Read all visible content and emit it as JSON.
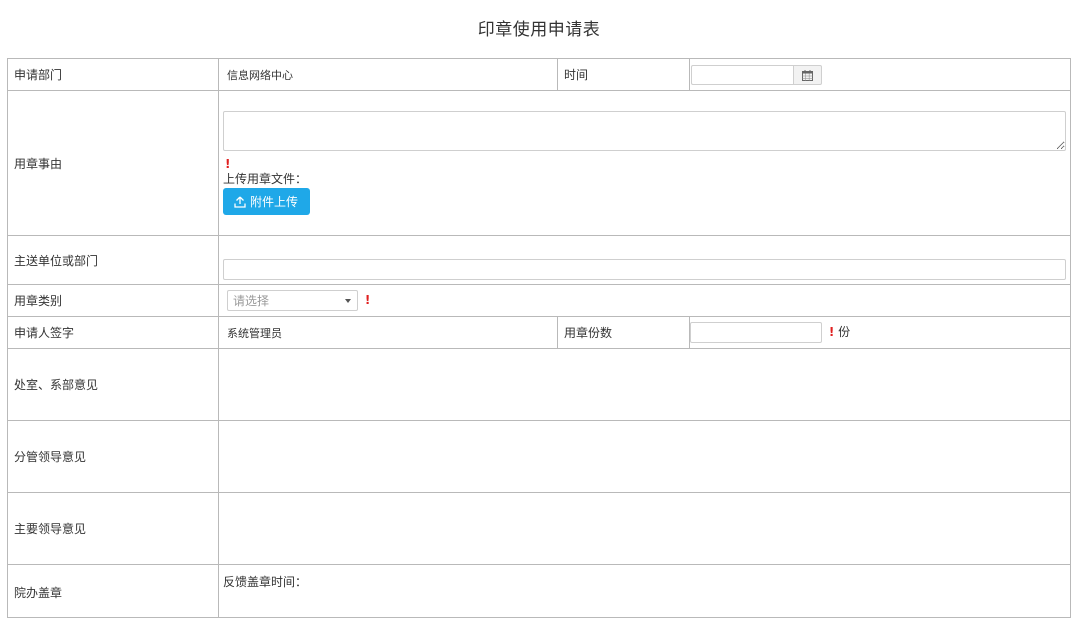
{
  "form": {
    "title": "印章使用申请表",
    "rows": {
      "dept": {
        "label": "申请部门",
        "value": "信息网络中心"
      },
      "time": {
        "label": "时间",
        "calendar_icon": "calendar-icon"
      },
      "reason": {
        "label": "用章事由",
        "required_mark": "!",
        "upload_label": "上传用章文件：",
        "upload_button": "附件上传",
        "upload_icon": "upload-icon"
      },
      "recipient": {
        "label": "主送单位或部门"
      },
      "category": {
        "label": "用章类别",
        "placeholder": "请选择",
        "required_mark": "!"
      },
      "signature": {
        "label": "申请人签字",
        "value": "系统管理员"
      },
      "copies": {
        "label": "用章份数",
        "required_mark": "!",
        "unit": "份"
      },
      "office_opinion": {
        "label": "处室、系部意见"
      },
      "leader_opinion": {
        "label": "分管领导意见"
      },
      "main_leader_opinion": {
        "label": "主要领导意见"
      },
      "seal": {
        "label": "院办盖章",
        "feedback_label": "反馈盖章时间："
      }
    }
  },
  "colors": {
    "border": "#b9b9b9",
    "upload_button": "#1fa8e8",
    "required": "#e02020"
  }
}
